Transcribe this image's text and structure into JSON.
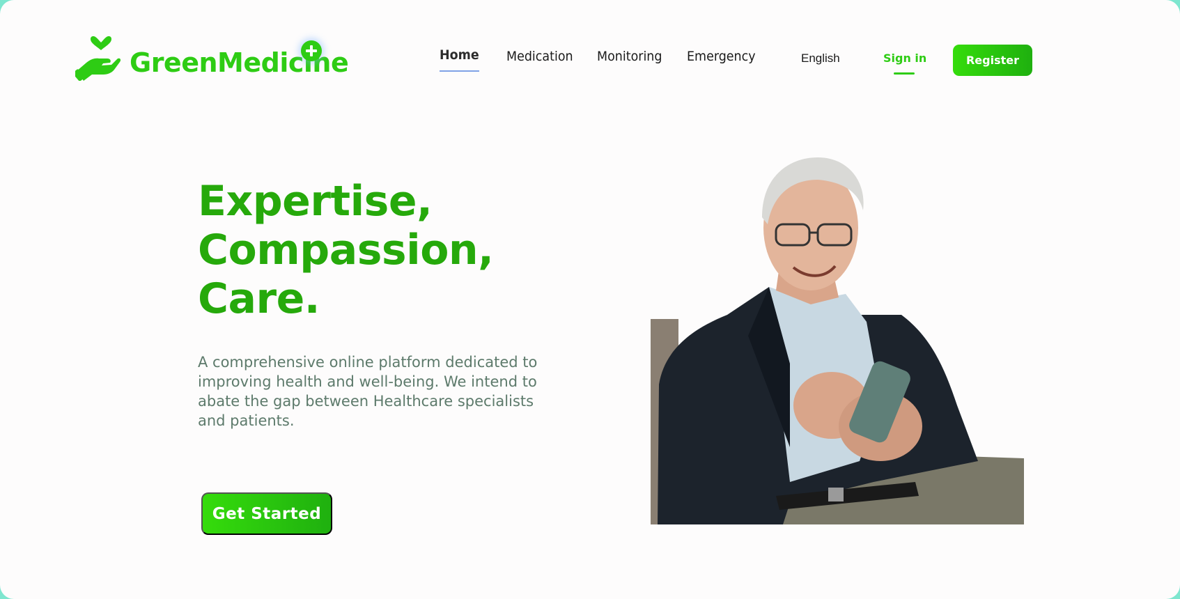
{
  "brand": {
    "name": "GreenMedicine",
    "color": "#2ecc14"
  },
  "nav": {
    "items": [
      {
        "label": "Home",
        "active": true
      },
      {
        "label": "Medication",
        "active": false
      },
      {
        "label": "Monitoring",
        "active": false
      },
      {
        "label": "Emergency",
        "active": false
      }
    ],
    "language": "English",
    "sign_in": "Sign in",
    "register": "Register"
  },
  "hero": {
    "title_lines": [
      "Expertise,",
      "Compassion,",
      "Care."
    ],
    "description": "A comprehensive online platform dedicated to improving health and well-being. We intend to abate the gap between Healthcare specialists and patients.",
    "cta": "Get Started",
    "title_color": "#26a90b",
    "text_color": "#5d7a6b"
  },
  "icons": {
    "logo": "hand-heart-icon",
    "plus": "plus-icon"
  }
}
